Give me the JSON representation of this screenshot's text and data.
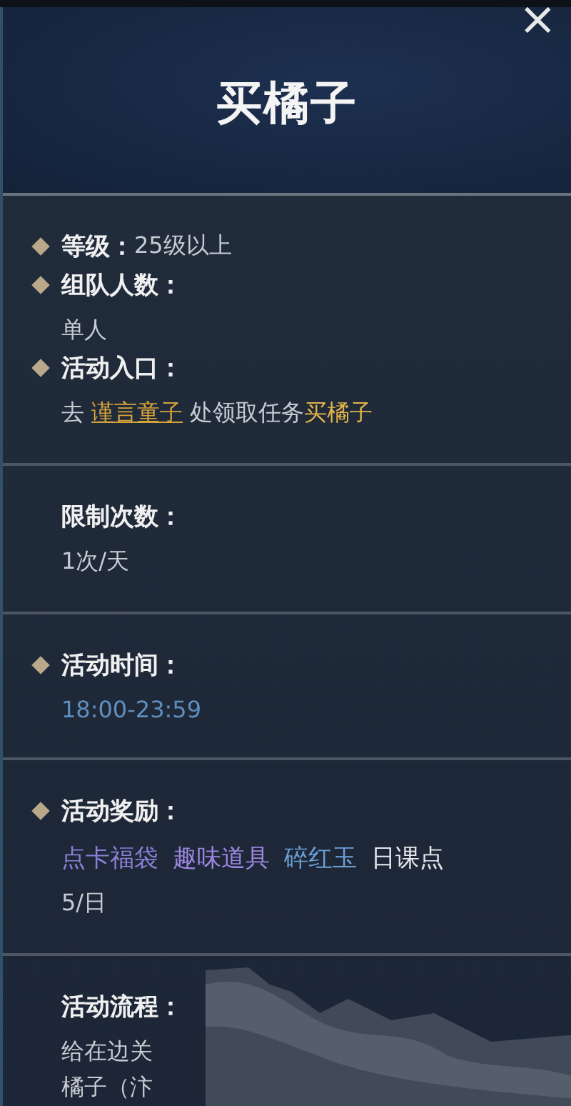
{
  "dialog": {
    "title": "买橘子",
    "close": "×"
  },
  "sections": [
    {
      "items": [
        {
          "bullet": true,
          "label": "等级：",
          "value": "25级以上",
          "inline": true
        },
        {
          "bullet": true,
          "label": "组队人数：",
          "value": "单人",
          "inline": false
        },
        {
          "bullet": true,
          "label": "活动入口：",
          "segments": [
            {
              "kind": "plain",
              "text": "去 "
            },
            {
              "kind": "link",
              "text": "谨言童子"
            },
            {
              "kind": "plain",
              "text": " 处领取任务"
            },
            {
              "kind": "highlight",
              "text": "买橘子"
            }
          ]
        }
      ]
    },
    {
      "items": [
        {
          "bullet": false,
          "label": "限制次数：",
          "value": "1次/天",
          "inline": false
        }
      ]
    },
    {
      "items": [
        {
          "bullet": true,
          "label": "活动时间：",
          "value": "18:00-23:59",
          "inline": false,
          "kind": "time"
        }
      ]
    },
    {
      "items": [
        {
          "bullet": true,
          "label": "活动奖励：",
          "rewards": [
            {
              "text": "点卡福袋",
              "color": "#8b7fd6"
            },
            {
              "text": "趣味道具",
              "color": "#9d86e0"
            },
            {
              "text": "碎红玉",
              "color": "#6c9fd6"
            },
            {
              "text": "日课点",
              "color": "#e6e8ec"
            }
          ],
          "reward_count": "5/日"
        }
      ]
    },
    {
      "items": [
        {
          "bullet": false,
          "label": "活动流程：",
          "lines": [
            "给在边关",
            "橘子（汴"
          ]
        }
      ]
    }
  ]
}
